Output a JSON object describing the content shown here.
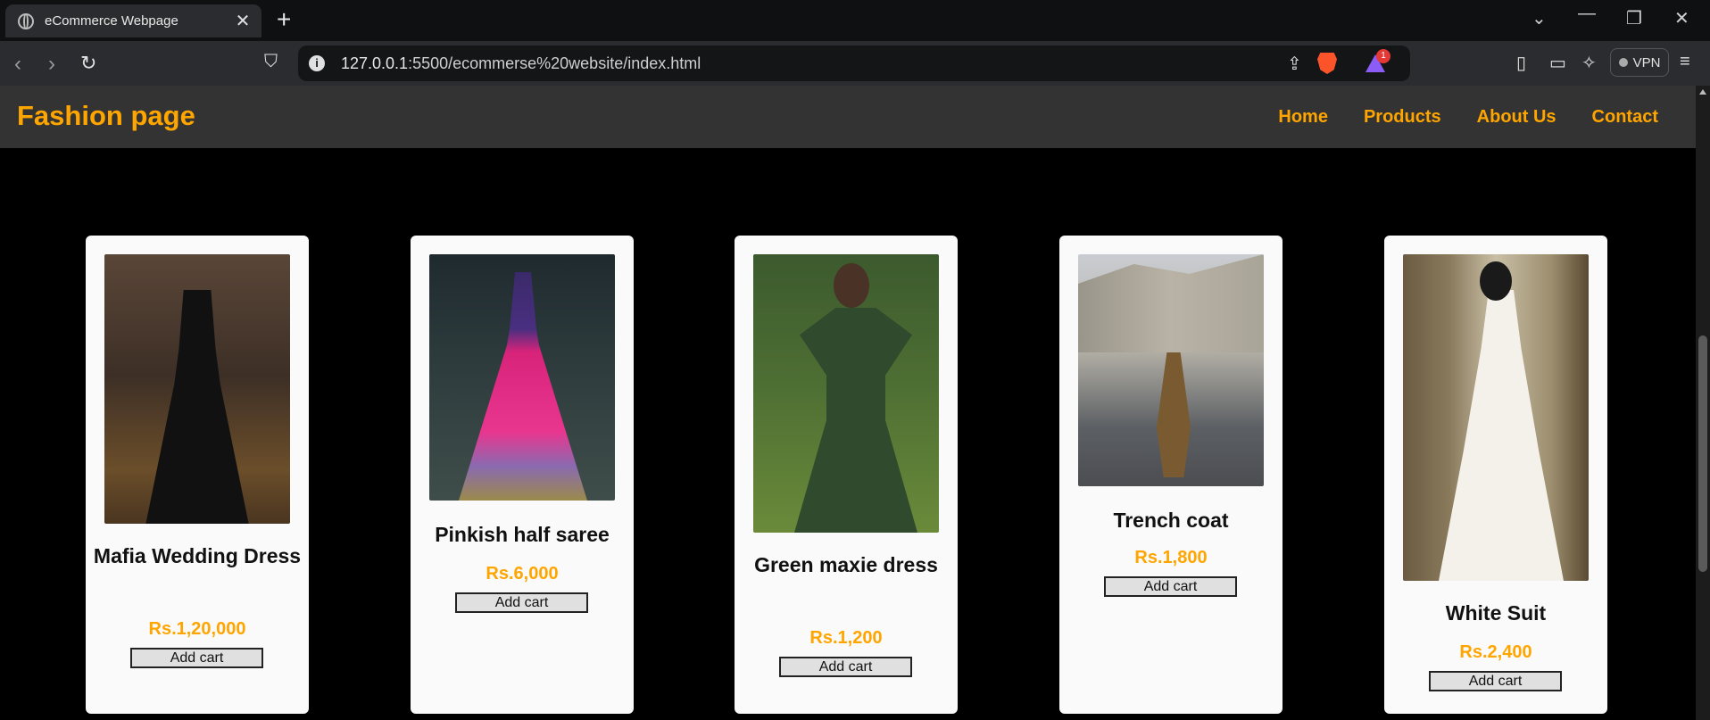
{
  "browser": {
    "tab_title": "eCommerce Webpage",
    "tab_close": "✕",
    "new_tab": "+",
    "url_host": "127.0.0.1",
    "url_rest": ":5500/ecommerse%20website/index.html",
    "rewards_count": "1",
    "vpn_label": "VPN"
  },
  "site": {
    "brand": "Fashion page",
    "nav": [
      "Home",
      "Products",
      "About Us",
      "Contact"
    ]
  },
  "products": [
    {
      "name": "Mafia Wedding Dress",
      "price": "Rs.1,20,000",
      "button": "Add cart"
    },
    {
      "name": "Pinkish half saree",
      "price": "Rs.6,000",
      "button": "Add cart"
    },
    {
      "name": "Green maxie dress",
      "price": "Rs.1,200",
      "button": "Add cart"
    },
    {
      "name": "Trench coat",
      "price": "Rs.1,800",
      "button": "Add cart"
    },
    {
      "name": "White Suit",
      "price": "Rs.2,400",
      "button": "Add cart"
    }
  ],
  "colors": {
    "accent": "#ffa500",
    "header_bg": "#333333",
    "page_bg": "#000000",
    "card_bg": "#fafafa"
  }
}
